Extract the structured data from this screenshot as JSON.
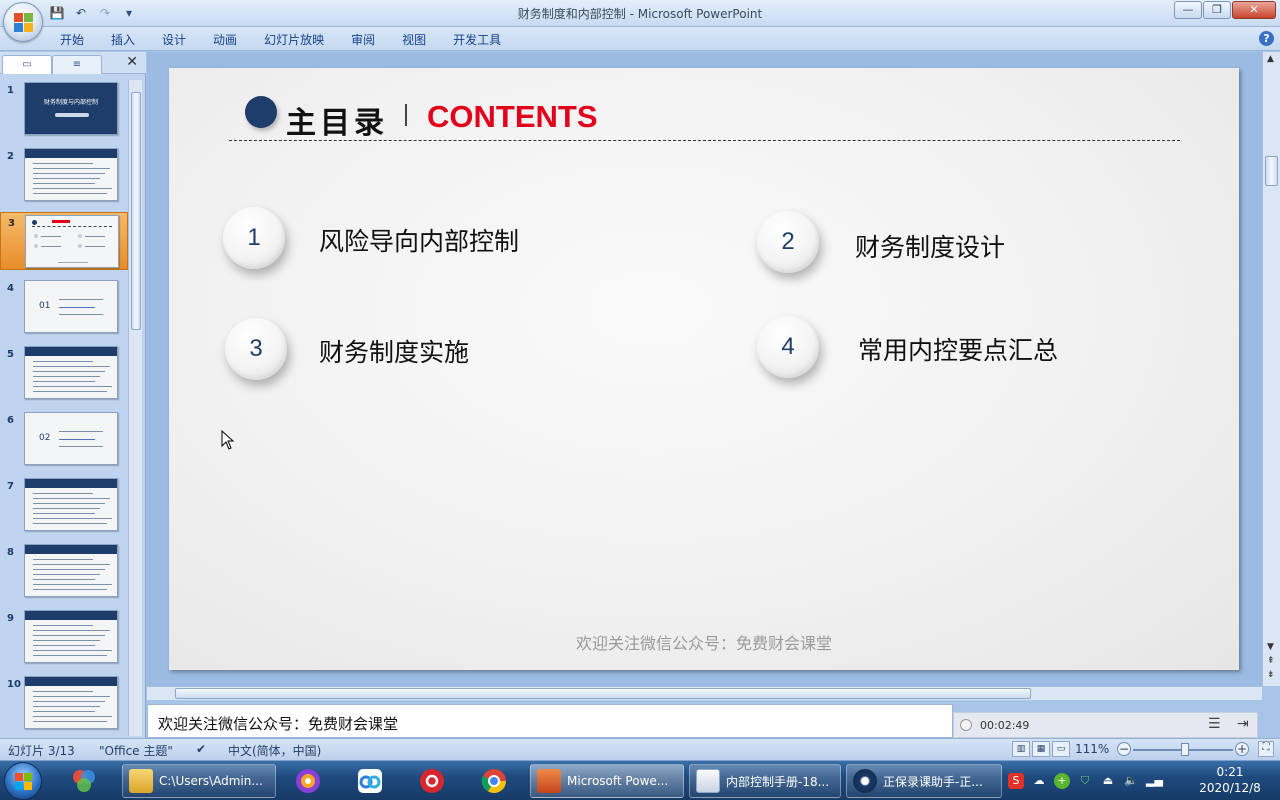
{
  "window": {
    "title": "财务制度和内部控制 - Microsoft PowerPoint",
    "controls": {
      "minimize": "—",
      "restore": "❐",
      "close": "✕"
    }
  },
  "qat": {
    "save": "💾",
    "undo": "↶",
    "redo": "↷",
    "more": "▾"
  },
  "ribbon": {
    "tabs": [
      "开始",
      "插入",
      "设计",
      "动画",
      "幻灯片放映",
      "审阅",
      "视图",
      "开发工具"
    ],
    "help": "?"
  },
  "left_panel": {
    "tab_slides": "▭",
    "tab_outline": "≡",
    "close": "✕",
    "slides": [
      {
        "num": "1",
        "kind": "title",
        "label": "财务制度与内部控制"
      },
      {
        "num": "2",
        "kind": "text"
      },
      {
        "num": "3",
        "kind": "contents",
        "selected": true
      },
      {
        "num": "4",
        "kind": "section",
        "label": "01"
      },
      {
        "num": "5",
        "kind": "text"
      },
      {
        "num": "6",
        "kind": "section",
        "label": "02"
      },
      {
        "num": "7",
        "kind": "text"
      },
      {
        "num": "8",
        "kind": "text"
      },
      {
        "num": "9",
        "kind": "text"
      },
      {
        "num": "10",
        "kind": "text"
      }
    ]
  },
  "slide": {
    "heading_cn": "主目录",
    "heading_en": "CONTENTS",
    "items": [
      {
        "num": "1",
        "text": "风险导向内部控制"
      },
      {
        "num": "2",
        "text": "财务制度设计"
      },
      {
        "num": "3",
        "text": "财务制度实施"
      },
      {
        "num": "4",
        "text": "常用内控要点汇总"
      }
    ],
    "footer": "欢迎关注微信公众号：免费财会课堂"
  },
  "notes": {
    "text": "欢迎关注微信公众号：免费财会课堂"
  },
  "recorder": {
    "time": "00:02:49"
  },
  "status": {
    "slide_info": "幻灯片 3/13",
    "theme": "\"Office 主题\"",
    "language": "中文(简体，中国)",
    "zoom": "111%",
    "zoom_level": 0.52
  },
  "taskbar": {
    "apps": [
      {
        "label": "C:\\Users\\Admin...",
        "icon": "folder-icon"
      },
      {
        "label": "Microsoft Powe...",
        "icon": "powerpoint-icon",
        "active": true
      },
      {
        "label": "内部控制手册-18...",
        "icon": "word-icon"
      },
      {
        "label": "正保录课助手-正...",
        "icon": "recorder-icon"
      }
    ],
    "clock_time": "0:21",
    "clock_date": "2020/12/8"
  },
  "colors": {
    "accent_navy": "#1f3d6b",
    "heading_red": "#e3001b",
    "selected_thumb": "#e88d2a"
  }
}
